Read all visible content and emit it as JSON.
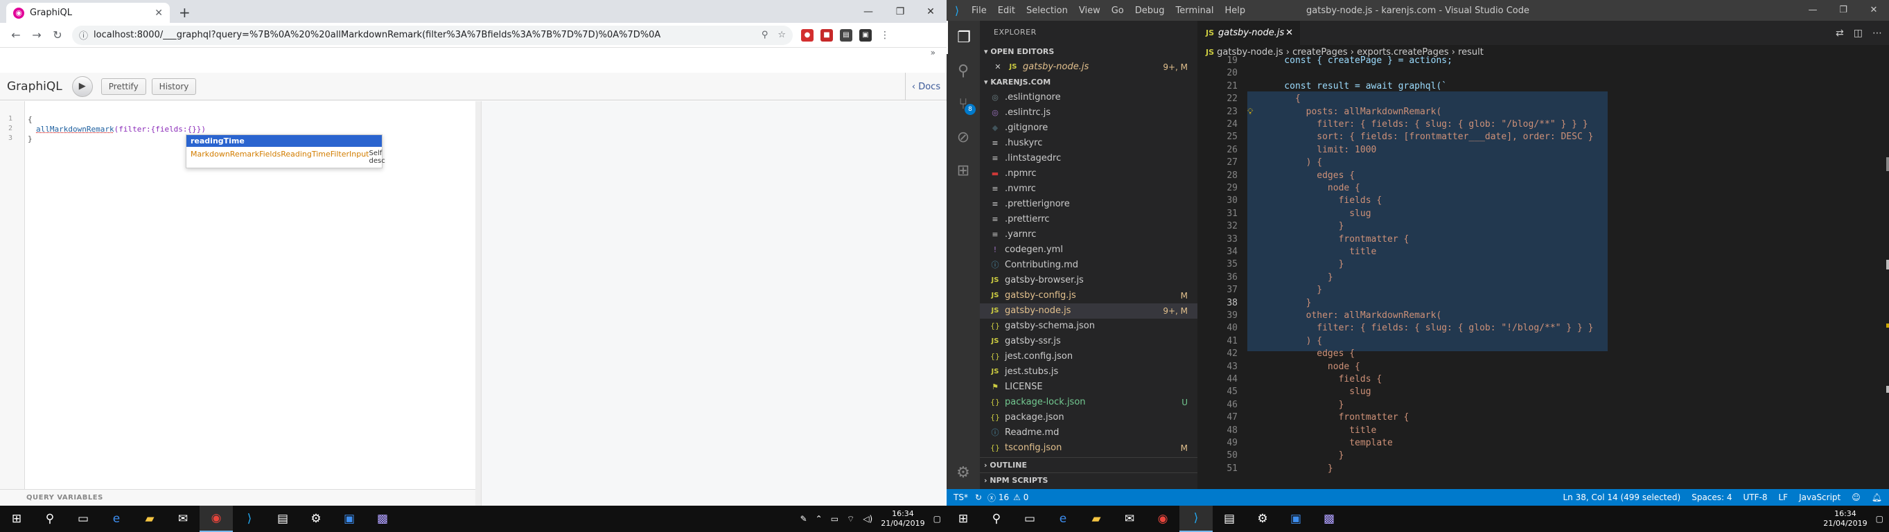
{
  "chrome": {
    "tab_title": "GraphiQL",
    "url": "localhost:8000/___graphql?query=%7B%0A%20%20allMarkdownRemark(filter%3A%7Bfields%3A%7B%7D%7D)%0A%7D%0A",
    "bookmarks_more": "»",
    "graphiql": {
      "title": "GraphiQL",
      "prettify": "Prettify",
      "history": "History",
      "docs": "Docs",
      "line_numbers": [
        "1",
        "2",
        "3"
      ],
      "code": {
        "open": "{",
        "fn": "allMarkdownRemark",
        "args": "(filter:{fields:{}})",
        "close": "}"
      },
      "autocomplete": {
        "selected": "readingTime",
        "item": "MarkdownRemarkFieldsReadingTimeFilterInput",
        "item_desc": "Self desc"
      },
      "query_variables": "QUERY VARIABLES"
    }
  },
  "vscode": {
    "menu": [
      "File",
      "Edit",
      "Selection",
      "View",
      "Go",
      "Debug",
      "Terminal",
      "Help"
    ],
    "window_title": "gatsby-node.js - karenjs.com - Visual Studio Code",
    "explorer_title": "EXPLORER",
    "open_editors": "OPEN EDITORS",
    "open_file": {
      "name": "gatsby-node.js",
      "status": "9+, M"
    },
    "project": "KARENJS.COM",
    "files": [
      {
        "name": ".eslintignore",
        "icon": "◎",
        "color": "#6d8086"
      },
      {
        "name": ".eslintrc.js",
        "icon": "◎",
        "color": "#a074c4"
      },
      {
        "name": ".gitignore",
        "icon": "◆",
        "color": "#41535b"
      },
      {
        "name": ".huskyrc",
        "icon": "≡",
        "color": "#ccc"
      },
      {
        "name": ".lintstagedrc",
        "icon": "≡",
        "color": "#ccc"
      },
      {
        "name": ".npmrc",
        "icon": "▬",
        "color": "#cb3837"
      },
      {
        "name": ".nvmrc",
        "icon": "≡",
        "color": "#ccc"
      },
      {
        "name": ".prettierignore",
        "icon": "≡",
        "color": "#ccc"
      },
      {
        "name": ".prettierrc",
        "icon": "≡",
        "color": "#ccc"
      },
      {
        "name": ".yarnrc",
        "icon": "≡",
        "color": "#ccc"
      },
      {
        "name": "codegen.yml",
        "icon": "!",
        "color": "#a074c4"
      },
      {
        "name": "Contributing.md",
        "icon": "ⓘ",
        "color": "#519aba"
      },
      {
        "name": "gatsby-browser.js",
        "icon": "JS",
        "color": "#cbcb41"
      },
      {
        "name": "gatsby-config.js",
        "icon": "JS",
        "color": "#cbcb41",
        "status": "M",
        "status_color": "#e2c08d",
        "text_color": "#e2c08d"
      },
      {
        "name": "gatsby-node.js",
        "icon": "JS",
        "color": "#cbcb41",
        "status": "9+, M",
        "status_color": "#e2c08d",
        "text_color": "#e2c08d",
        "selected": true
      },
      {
        "name": "gatsby-schema.json",
        "icon": "{}",
        "color": "#cbcb41"
      },
      {
        "name": "gatsby-ssr.js",
        "icon": "JS",
        "color": "#cbcb41"
      },
      {
        "name": "jest.config.json",
        "icon": "{}",
        "color": "#cbcb41"
      },
      {
        "name": "jest.stubs.js",
        "icon": "JS",
        "color": "#cbcb41"
      },
      {
        "name": "LICENSE",
        "icon": "⚑",
        "color": "#cbcb41"
      },
      {
        "name": "package-lock.json",
        "icon": "{}",
        "color": "#cbcb41",
        "status": "U",
        "status_color": "#73c991",
        "text_color": "#73c991"
      },
      {
        "name": "package.json",
        "icon": "{}",
        "color": "#cbcb41"
      },
      {
        "name": "Readme.md",
        "icon": "ⓘ",
        "color": "#519aba"
      },
      {
        "name": "tsconfig.json",
        "icon": "{}",
        "color": "#cbcb41",
        "status": "M",
        "status_color": "#e2c08d",
        "text_color": "#e2c08d"
      }
    ],
    "outline": "OUTLINE",
    "npm_scripts": "NPM SCRIPTS",
    "tab": "gatsby-node.js",
    "breadcrumb": [
      "gatsby-node.js",
      "createPages",
      "exports.createPages",
      "result"
    ],
    "code_lines": [
      {
        "n": "19",
        "t": "    const { createPage } = actions;"
      },
      {
        "n": "20",
        "t": ""
      },
      {
        "n": "21",
        "t": "    const result = await graphql(`"
      },
      {
        "n": "22",
        "t": "      {"
      },
      {
        "n": "23",
        "t": "        posts: allMarkdownRemark("
      },
      {
        "n": "24",
        "t": "          filter: { fields: { slug: { glob: \"/blog/**\" } } }"
      },
      {
        "n": "25",
        "t": "          sort: { fields: [frontmatter___date], order: DESC }"
      },
      {
        "n": "26",
        "t": "          limit: 1000"
      },
      {
        "n": "27",
        "t": "        ) {"
      },
      {
        "n": "28",
        "t": "          edges {"
      },
      {
        "n": "29",
        "t": "            node {"
      },
      {
        "n": "30",
        "t": "              fields {"
      },
      {
        "n": "31",
        "t": "                slug"
      },
      {
        "n": "32",
        "t": "              }"
      },
      {
        "n": "33",
        "t": "              frontmatter {"
      },
      {
        "n": "34",
        "t": "                title"
      },
      {
        "n": "35",
        "t": "              }"
      },
      {
        "n": "36",
        "t": "            }"
      },
      {
        "n": "37",
        "t": "          }"
      },
      {
        "n": "38",
        "t": "        }"
      },
      {
        "n": "39",
        "t": "        other: allMarkdownRemark("
      },
      {
        "n": "40",
        "t": "          filter: { fields: { slug: { glob: \"!/blog/**\" } } }"
      },
      {
        "n": "41",
        "t": "        ) {"
      },
      {
        "n": "42",
        "t": "          edges {"
      },
      {
        "n": "43",
        "t": "            node {"
      },
      {
        "n": "44",
        "t": "              fields {"
      },
      {
        "n": "45",
        "t": "                slug"
      },
      {
        "n": "46",
        "t": "              }"
      },
      {
        "n": "47",
        "t": "              frontmatter {"
      },
      {
        "n": "48",
        "t": "                title"
      },
      {
        "n": "49",
        "t": "                template"
      },
      {
        "n": "50",
        "t": "              }"
      },
      {
        "n": "51",
        "t": "            }"
      }
    ],
    "status": {
      "ts": "TS*",
      "errors": "16",
      "warnings": "0",
      "position": "Ln 38, Col 14 (499 selected)",
      "spaces": "Spaces: 4",
      "encoding": "UTF-8",
      "eol": "LF",
      "language": "JavaScript"
    }
  },
  "taskbar": {
    "time": "16:34",
    "date": "21/04/2019"
  }
}
